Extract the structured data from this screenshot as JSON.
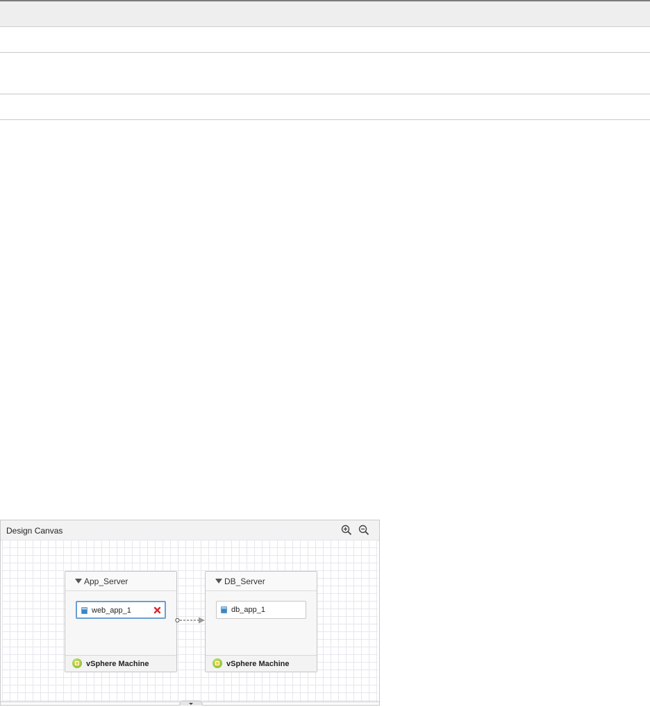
{
  "canvas": {
    "title": "Design Canvas",
    "zoom_in_icon": "zoom-in-icon",
    "zoom_out_icon": "zoom-out-icon"
  },
  "nodes": [
    {
      "name": "App_Server",
      "type_label": "vSphere Machine",
      "component": {
        "label": "web_app_1",
        "selected": true,
        "deletable": true
      }
    },
    {
      "name": "DB_Server",
      "type_label": "vSphere Machine",
      "component": {
        "label": "db_app_1",
        "selected": false,
        "deletable": false
      }
    }
  ],
  "colors": {
    "selection": "#6a9fd0",
    "delete": "#d9272d",
    "vsphere": "#7fb51c"
  }
}
